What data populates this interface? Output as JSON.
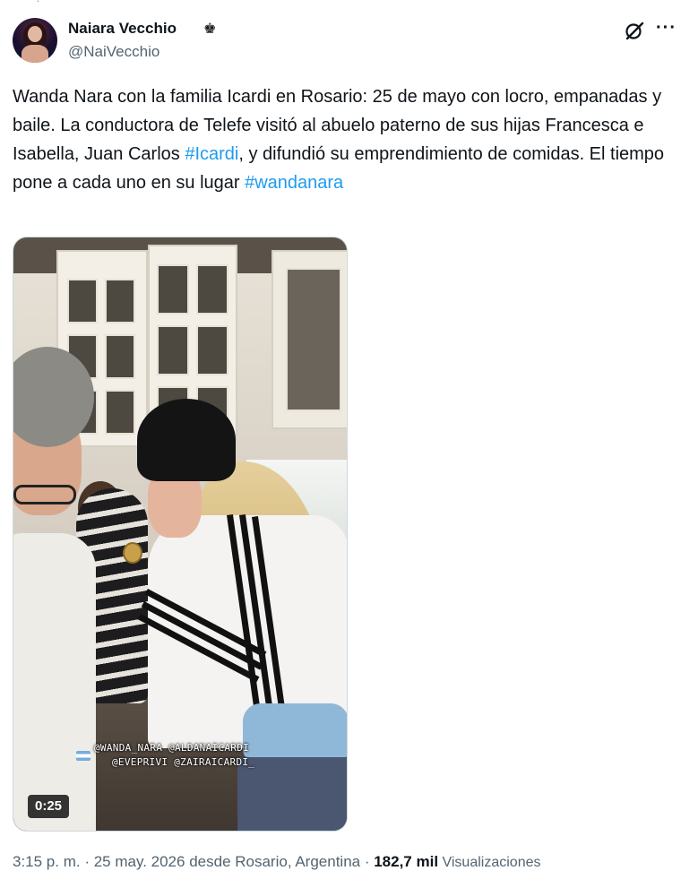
{
  "author": {
    "name": "Naiara Vecchio",
    "badge_glyph": "♚",
    "handle": "@NaiVecchio"
  },
  "header_icons": {
    "grok": "grok-icon",
    "more": "more-icon"
  },
  "tweet": {
    "text_parts": [
      "Wanda Nara con la familia Icardi en Rosario: 25 de mayo con locro, empanadas y baile. La conductora de Telefe visitó al abuelo paterno de sus hijas Francesca e Isabella, Juan Carlos ",
      "#Icardi",
      ", y difundió su emprendimiento de comidas. El tiempo pone a cada uno en su lugar ",
      "#wandanara"
    ]
  },
  "media": {
    "overlay_line1": "@WANDA_NARA @ALDANAICARDI",
    "overlay_line2": "@EVEPRIVI @ZAIRAICARDI_",
    "duration": "0:25"
  },
  "meta": {
    "time": "3:15 p. m.",
    "sep1": " · ",
    "date": "25 may. 2026",
    "location": " desde Rosario, Argentina",
    "sep2": " · ",
    "views_count": "182,7 mil",
    "views_label": " Visualizaciones"
  },
  "colors": {
    "link": "#1d9bf0",
    "text": "#0f1419",
    "muted": "#536471"
  }
}
